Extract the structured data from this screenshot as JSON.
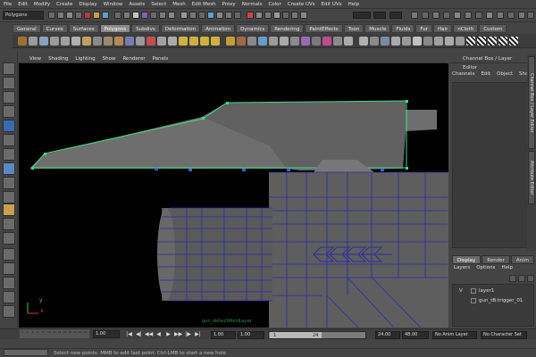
{
  "menubar": [
    "File",
    "Edit",
    "Modify",
    "Create",
    "Display",
    "Window",
    "Assets",
    "Select",
    "Mesh",
    "Edit Mesh",
    "Proxy",
    "Normals",
    "Color",
    "Create UVs",
    "Edit UVs",
    "Help"
  ],
  "statusline": {
    "mode": "Polygons"
  },
  "shelf_tabs": [
    "General",
    "Curves",
    "Surfaces",
    "Polygons",
    "Subdivs",
    "Deformation",
    "Animation",
    "Dynamics",
    "Rendering",
    "PaintEffects",
    "Toon",
    "Muscle",
    "Fluids",
    "Fur",
    "Hair",
    "nCloth",
    "Custom"
  ],
  "shelf_active": "Polygons",
  "viewport_menu": [
    "View",
    "Shading",
    "Lighting",
    "Show",
    "Renderer",
    "Panels"
  ],
  "viewport_overlay": "gun_defaultWeldLayer",
  "axis": {
    "x": "x",
    "y": "y"
  },
  "channel_box": {
    "title": "Channel Box / Layer Editor",
    "menu": [
      "Channels",
      "Edit",
      "Object",
      "Show"
    ]
  },
  "side_tabs": [
    "Channel Box / Layer Editor",
    "Attribute Editor"
  ],
  "layer_editor": {
    "tabs": [
      "Display",
      "Render",
      "Anim"
    ],
    "active_tab": "Display",
    "menu": [
      "Layers",
      "Options",
      "Help"
    ],
    "layers": [
      {
        "visible": "V",
        "name": "layer1"
      },
      {
        "visible": "",
        "name": "gun_tB:trigger_01"
      }
    ]
  },
  "time_slider": {
    "current_frame": "1.00",
    "ruler_labels": [
      "1",
      "2",
      "4",
      "6",
      "8",
      "10",
      "12",
      "14",
      "16",
      "18",
      "20",
      "22",
      "24"
    ]
  },
  "range_slider": {
    "start": "1.00",
    "inner_start": "1.00",
    "slider_start": "1",
    "slider_end": "24",
    "inner_end": "24.00",
    "end": "48.00",
    "anim_layer": "No Anim Layer",
    "char_set": "No Character Set"
  },
  "playback": [
    "|◀",
    "◀|",
    "◀◀",
    "◀",
    "▶",
    "▶▶",
    "|▶",
    "▶|"
  ],
  "help_line": "Select new points. MMB to edit last point. Ctrl-LMB to start a new hole",
  "colors": {
    "wire_selected": "#3ddc84",
    "wire_mesh": "#2a2aa8",
    "mesh_fill": "#6b6b6b"
  }
}
